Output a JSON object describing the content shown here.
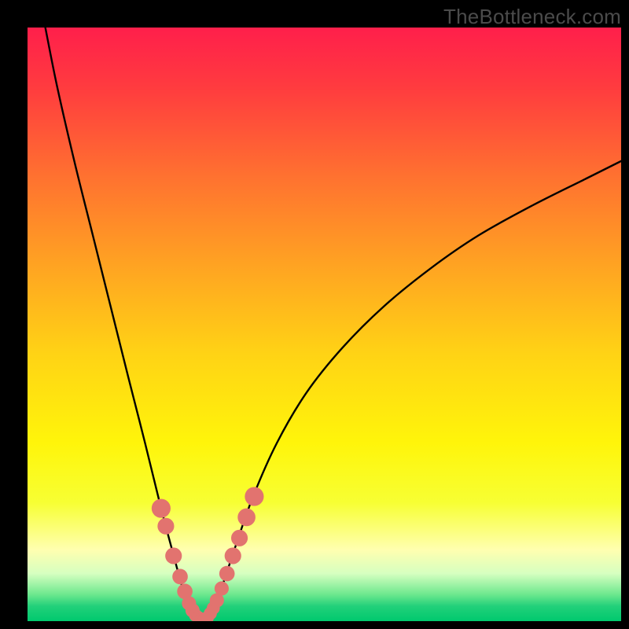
{
  "watermark": "TheBottleneck.com",
  "gradient": {
    "stops": [
      {
        "offset": 0.0,
        "color": "#ff1f4b"
      },
      {
        "offset": 0.1,
        "color": "#ff3b3f"
      },
      {
        "offset": 0.25,
        "color": "#ff7130"
      },
      {
        "offset": 0.4,
        "color": "#ffa322"
      },
      {
        "offset": 0.55,
        "color": "#ffd315"
      },
      {
        "offset": 0.7,
        "color": "#fff50a"
      },
      {
        "offset": 0.8,
        "color": "#f7ff33"
      },
      {
        "offset": 0.88,
        "color": "#ffffb0"
      },
      {
        "offset": 0.92,
        "color": "#d6ffc0"
      },
      {
        "offset": 0.955,
        "color": "#6de88e"
      },
      {
        "offset": 0.975,
        "color": "#22d07a"
      },
      {
        "offset": 1.0,
        "color": "#00c96e"
      }
    ]
  },
  "chart_data": {
    "type": "line",
    "title": "",
    "xlabel": "",
    "ylabel": "",
    "xlim": [
      0,
      100
    ],
    "ylim": [
      0,
      100
    ],
    "series": [
      {
        "name": "bottleneck-curve",
        "x": [
          3.0,
          5.0,
          8.0,
          11.0,
          14.0,
          17.0,
          19.8,
          22.5,
          24.5,
          26.0,
          27.3,
          28.5,
          29.5,
          30.3,
          31.5,
          33.0,
          35.0,
          38.0,
          42.0,
          47.0,
          53.0,
          60.0,
          68.0,
          76.0,
          85.0,
          94.0,
          100.0
        ],
        "values": [
          100.0,
          90.0,
          77.0,
          65.0,
          53.0,
          41.0,
          30.0,
          19.0,
          11.5,
          6.0,
          2.5,
          0.6,
          0.2,
          0.6,
          2.5,
          6.5,
          12.5,
          21.0,
          30.0,
          38.5,
          46.0,
          53.0,
          59.5,
          65.0,
          70.0,
          74.5,
          77.5
        ]
      }
    ],
    "markers": {
      "name": "highlighted-points",
      "color": "#e2736f",
      "points": [
        {
          "x": 22.5,
          "y": 19.0,
          "r": 1.6
        },
        {
          "x": 23.3,
          "y": 16.0,
          "r": 1.4
        },
        {
          "x": 24.6,
          "y": 11.0,
          "r": 1.4
        },
        {
          "x": 25.7,
          "y": 7.5,
          "r": 1.3
        },
        {
          "x": 26.5,
          "y": 5.0,
          "r": 1.3
        },
        {
          "x": 27.2,
          "y": 3.0,
          "r": 1.2
        },
        {
          "x": 27.8,
          "y": 1.8,
          "r": 1.2
        },
        {
          "x": 28.3,
          "y": 1.0,
          "r": 1.1
        },
        {
          "x": 28.8,
          "y": 0.6,
          "r": 1.1
        },
        {
          "x": 29.3,
          "y": 0.3,
          "r": 1.1
        },
        {
          "x": 29.8,
          "y": 0.3,
          "r": 1.1
        },
        {
          "x": 30.3,
          "y": 0.6,
          "r": 1.1
        },
        {
          "x": 30.8,
          "y": 1.3,
          "r": 1.1
        },
        {
          "x": 31.3,
          "y": 2.2,
          "r": 1.1
        },
        {
          "x": 31.9,
          "y": 3.5,
          "r": 1.2
        },
        {
          "x": 32.7,
          "y": 5.5,
          "r": 1.2
        },
        {
          "x": 33.6,
          "y": 8.0,
          "r": 1.3
        },
        {
          "x": 34.6,
          "y": 11.0,
          "r": 1.4
        },
        {
          "x": 35.7,
          "y": 14.0,
          "r": 1.4
        },
        {
          "x": 36.9,
          "y": 17.5,
          "r": 1.5
        },
        {
          "x": 38.2,
          "y": 21.0,
          "r": 1.6
        }
      ]
    }
  }
}
